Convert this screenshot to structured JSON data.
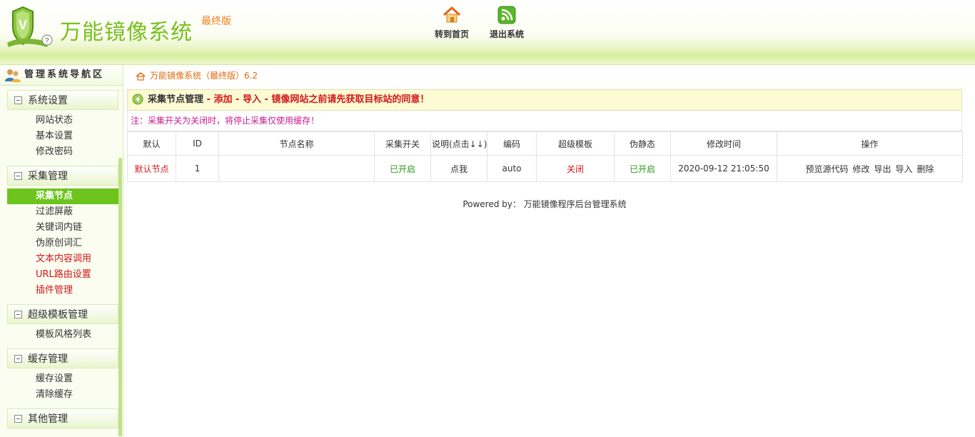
{
  "header": {
    "title": "万能镜像系统",
    "edition": "最终版",
    "nav": [
      {
        "label": "转到首页",
        "icon": "home-icon"
      },
      {
        "label": "退出系统",
        "icon": "rss-icon"
      }
    ]
  },
  "sidebar": {
    "heading": "管理系统导航区",
    "groups": [
      {
        "title": "系统设置",
        "items": [
          {
            "label": "网站状态"
          },
          {
            "label": "基本设置"
          },
          {
            "label": "修改密码"
          }
        ]
      },
      {
        "title": "采集管理",
        "items": [
          {
            "label": "采集节点"
          },
          {
            "label": "过滤屏蔽"
          },
          {
            "label": "关键词内链"
          },
          {
            "label": "伪原创词汇"
          },
          {
            "label": "文本内容调用"
          },
          {
            "label": "URL路由设置"
          },
          {
            "label": "插件管理"
          }
        ]
      },
      {
        "title": "超级模板管理",
        "items": [
          {
            "label": "模板风格列表"
          }
        ]
      },
      {
        "title": "缓存管理",
        "items": [
          {
            "label": "缓存设置"
          },
          {
            "label": "清除缓存"
          }
        ]
      },
      {
        "title": "其他管理",
        "items": []
      }
    ]
  },
  "breadcrumb": "万能镜像系统（最终版）6.2",
  "panel": {
    "title": "采集节点管理",
    "sep1": " - ",
    "add": "添加",
    "sep2": " - ",
    "import": "导入",
    "sep3": " - ",
    "warning": "镜像网站之前请先获取目标站的同意！"
  },
  "notice": "注：采集开关为关闭时，将停止采集仅使用缓存！",
  "table": {
    "headers": [
      "默认",
      "ID",
      "节点名称",
      "采集开关",
      "说明(点击↓↓)",
      "编码",
      "超级模板",
      "伪静态",
      "修改时间",
      "操作"
    ],
    "rows": [
      {
        "default": "默认节点",
        "id": "1",
        "name": "",
        "switch": "已开启",
        "desc": "点我",
        "encoding": "auto",
        "template": "关闭",
        "pseudo_static": "已开启",
        "modified": "2020-09-12 21:05:50",
        "actions": [
          "预览源代码",
          "修改",
          "导出",
          "导入",
          "删除"
        ]
      }
    ]
  },
  "footer": "Powered by： 万能镜像程序后台管理系统",
  "colors": {
    "accent": "#6cc41d",
    "brand": "#78c01e",
    "warning": "#d21818",
    "edition": "#f08020"
  }
}
